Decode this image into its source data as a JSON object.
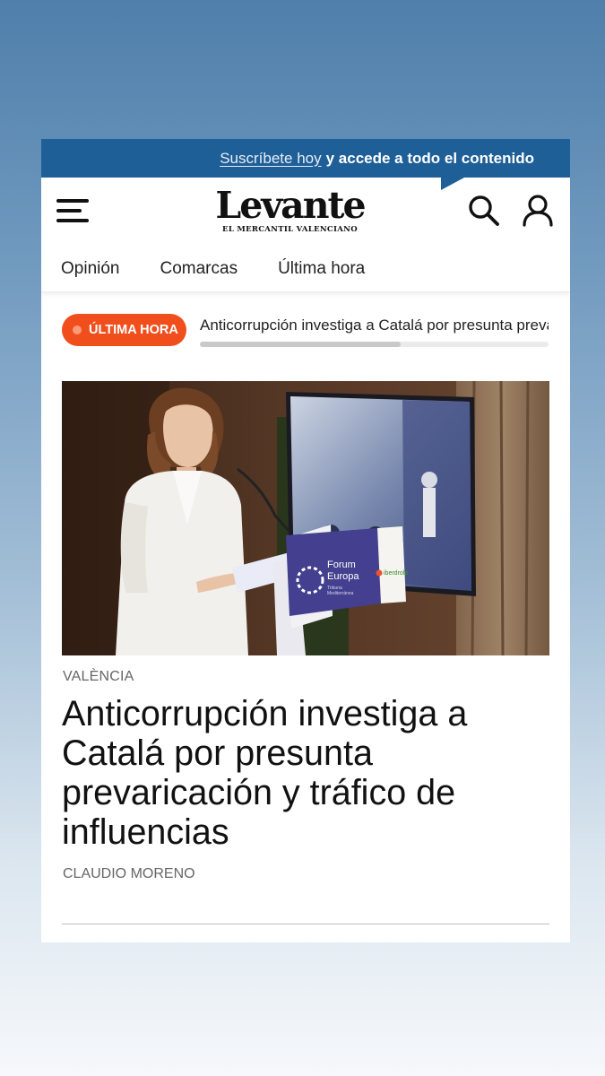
{
  "subscribe_bar": {
    "link_text": "Suscríbete hoy",
    "rest_text": "y accede a todo el contenido"
  },
  "header": {
    "logo_name": "Levante",
    "logo_subtitle": "EL MERCANTIL VALENCIANO",
    "icons": [
      "menu-icon",
      "search-icon",
      "user-icon"
    ]
  },
  "nav": {
    "items": [
      {
        "label": "Opinión"
      },
      {
        "label": "Comarcas"
      },
      {
        "label": "Última hora"
      }
    ]
  },
  "breaking": {
    "badge_label": "ÚLTIMA HORA",
    "ticker_text": "Anticorrupción investiga a Catalá por presunta prevaricación y tráfico de influencias",
    "progress": 0.576
  },
  "article": {
    "section": "VALÈNCIA",
    "headline": "Anticorrupción investiga a Catalá por presunta prevaricación y tráfico de influencias",
    "author": "CLAUDIO MORENO",
    "photo": {
      "podium_title_1": "Forum",
      "podium_title_2": "Europa",
      "podium_subtitle_1": "Tribuna",
      "podium_subtitle_2": "Mediterránea",
      "sponsor": "iberdrola"
    }
  },
  "colors": {
    "subscribe_bar": "#1f5f97",
    "badge": "#f04e1c",
    "text": "#111111",
    "meta_text": "#666666"
  }
}
